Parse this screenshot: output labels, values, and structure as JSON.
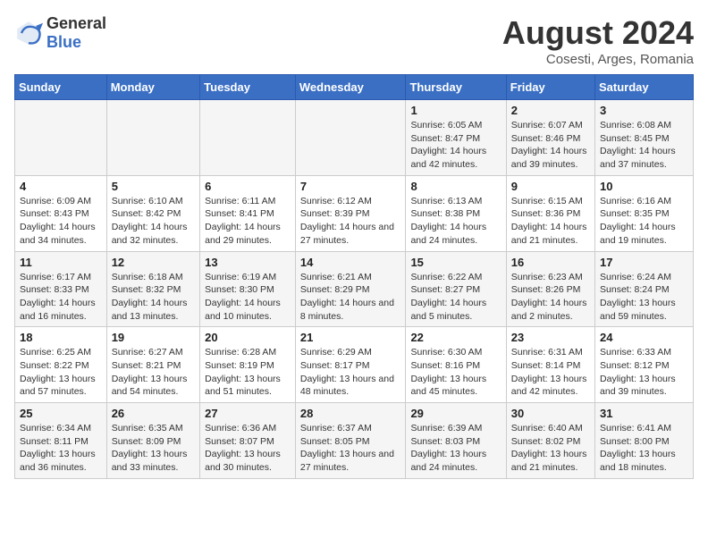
{
  "logo": {
    "text_general": "General",
    "text_blue": "Blue"
  },
  "title": "August 2024",
  "subtitle": "Cosesti, Arges, Romania",
  "weekdays": [
    "Sunday",
    "Monday",
    "Tuesday",
    "Wednesday",
    "Thursday",
    "Friday",
    "Saturday"
  ],
  "weeks": [
    [
      {
        "day": "",
        "info": ""
      },
      {
        "day": "",
        "info": ""
      },
      {
        "day": "",
        "info": ""
      },
      {
        "day": "",
        "info": ""
      },
      {
        "day": "1",
        "info": "Sunrise: 6:05 AM\nSunset: 8:47 PM\nDaylight: 14 hours and 42 minutes."
      },
      {
        "day": "2",
        "info": "Sunrise: 6:07 AM\nSunset: 8:46 PM\nDaylight: 14 hours and 39 minutes."
      },
      {
        "day": "3",
        "info": "Sunrise: 6:08 AM\nSunset: 8:45 PM\nDaylight: 14 hours and 37 minutes."
      }
    ],
    [
      {
        "day": "4",
        "info": "Sunrise: 6:09 AM\nSunset: 8:43 PM\nDaylight: 14 hours and 34 minutes."
      },
      {
        "day": "5",
        "info": "Sunrise: 6:10 AM\nSunset: 8:42 PM\nDaylight: 14 hours and 32 minutes."
      },
      {
        "day": "6",
        "info": "Sunrise: 6:11 AM\nSunset: 8:41 PM\nDaylight: 14 hours and 29 minutes."
      },
      {
        "day": "7",
        "info": "Sunrise: 6:12 AM\nSunset: 8:39 PM\nDaylight: 14 hours and 27 minutes."
      },
      {
        "day": "8",
        "info": "Sunrise: 6:13 AM\nSunset: 8:38 PM\nDaylight: 14 hours and 24 minutes."
      },
      {
        "day": "9",
        "info": "Sunrise: 6:15 AM\nSunset: 8:36 PM\nDaylight: 14 hours and 21 minutes."
      },
      {
        "day": "10",
        "info": "Sunrise: 6:16 AM\nSunset: 8:35 PM\nDaylight: 14 hours and 19 minutes."
      }
    ],
    [
      {
        "day": "11",
        "info": "Sunrise: 6:17 AM\nSunset: 8:33 PM\nDaylight: 14 hours and 16 minutes."
      },
      {
        "day": "12",
        "info": "Sunrise: 6:18 AM\nSunset: 8:32 PM\nDaylight: 14 hours and 13 minutes."
      },
      {
        "day": "13",
        "info": "Sunrise: 6:19 AM\nSunset: 8:30 PM\nDaylight: 14 hours and 10 minutes."
      },
      {
        "day": "14",
        "info": "Sunrise: 6:21 AM\nSunset: 8:29 PM\nDaylight: 14 hours and 8 minutes."
      },
      {
        "day": "15",
        "info": "Sunrise: 6:22 AM\nSunset: 8:27 PM\nDaylight: 14 hours and 5 minutes."
      },
      {
        "day": "16",
        "info": "Sunrise: 6:23 AM\nSunset: 8:26 PM\nDaylight: 14 hours and 2 minutes."
      },
      {
        "day": "17",
        "info": "Sunrise: 6:24 AM\nSunset: 8:24 PM\nDaylight: 13 hours and 59 minutes."
      }
    ],
    [
      {
        "day": "18",
        "info": "Sunrise: 6:25 AM\nSunset: 8:22 PM\nDaylight: 13 hours and 57 minutes."
      },
      {
        "day": "19",
        "info": "Sunrise: 6:27 AM\nSunset: 8:21 PM\nDaylight: 13 hours and 54 minutes."
      },
      {
        "day": "20",
        "info": "Sunrise: 6:28 AM\nSunset: 8:19 PM\nDaylight: 13 hours and 51 minutes."
      },
      {
        "day": "21",
        "info": "Sunrise: 6:29 AM\nSunset: 8:17 PM\nDaylight: 13 hours and 48 minutes."
      },
      {
        "day": "22",
        "info": "Sunrise: 6:30 AM\nSunset: 8:16 PM\nDaylight: 13 hours and 45 minutes."
      },
      {
        "day": "23",
        "info": "Sunrise: 6:31 AM\nSunset: 8:14 PM\nDaylight: 13 hours and 42 minutes."
      },
      {
        "day": "24",
        "info": "Sunrise: 6:33 AM\nSunset: 8:12 PM\nDaylight: 13 hours and 39 minutes."
      }
    ],
    [
      {
        "day": "25",
        "info": "Sunrise: 6:34 AM\nSunset: 8:11 PM\nDaylight: 13 hours and 36 minutes."
      },
      {
        "day": "26",
        "info": "Sunrise: 6:35 AM\nSunset: 8:09 PM\nDaylight: 13 hours and 33 minutes."
      },
      {
        "day": "27",
        "info": "Sunrise: 6:36 AM\nSunset: 8:07 PM\nDaylight: 13 hours and 30 minutes."
      },
      {
        "day": "28",
        "info": "Sunrise: 6:37 AM\nSunset: 8:05 PM\nDaylight: 13 hours and 27 minutes."
      },
      {
        "day": "29",
        "info": "Sunrise: 6:39 AM\nSunset: 8:03 PM\nDaylight: 13 hours and 24 minutes."
      },
      {
        "day": "30",
        "info": "Sunrise: 6:40 AM\nSunset: 8:02 PM\nDaylight: 13 hours and 21 minutes."
      },
      {
        "day": "31",
        "info": "Sunrise: 6:41 AM\nSunset: 8:00 PM\nDaylight: 13 hours and 18 minutes."
      }
    ]
  ]
}
